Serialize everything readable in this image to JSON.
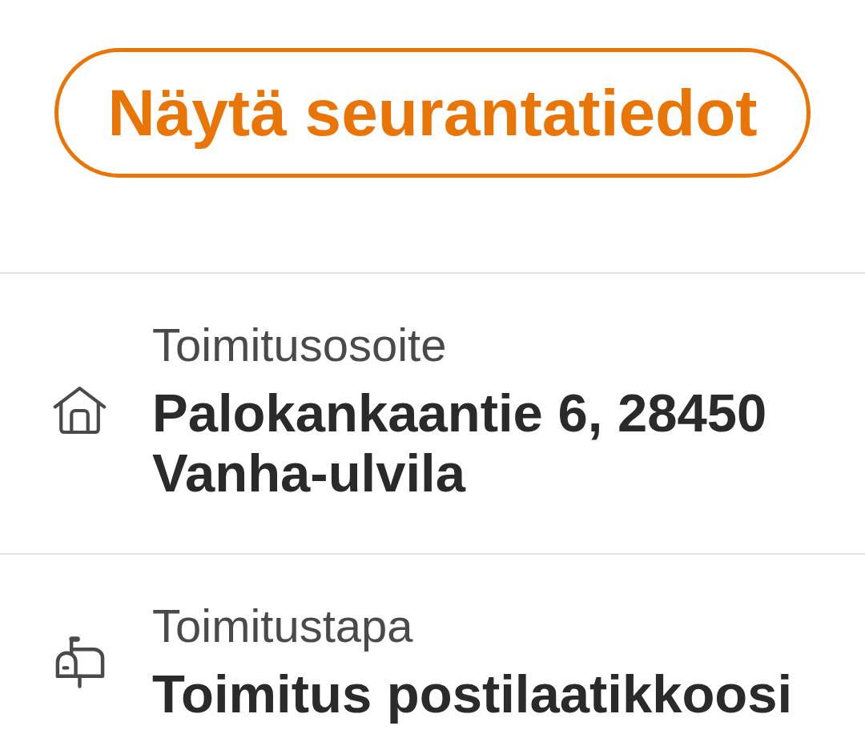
{
  "tracking_button": {
    "label": "Näytä seurantatiedot"
  },
  "details": [
    {
      "kind": "address",
      "label": "Toimitusosoite",
      "value": "Palokankaantie 6, 28450 Vanha-ulvila"
    },
    {
      "kind": "delivery_method",
      "label": "Toimitustapa",
      "value": "Toimitus postilaatikkoosi"
    }
  ]
}
